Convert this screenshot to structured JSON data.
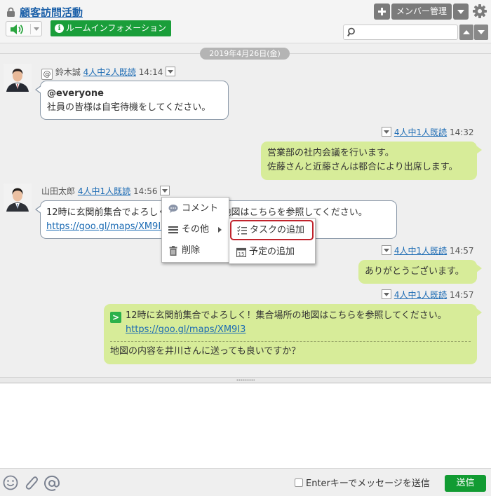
{
  "header": {
    "room_title": "顧客訪問活動",
    "info_button": "ルームインフォメーション",
    "member_button": "メンバー管理",
    "search_placeholder": ""
  },
  "date_separator": "2019年4月26日(金)",
  "messages": [
    {
      "sender": "鈴木誠",
      "read": "4人中2人既読",
      "time": "14:14",
      "line1": "@everyone",
      "line2": "社員の皆様は自宅待機をしてください。"
    },
    {
      "read": "4人中1人既読",
      "time": "14:32",
      "line1": "営業部の社内会議を行います。",
      "line2": "佐藤さんと近藤さんは都合により出席します。"
    },
    {
      "sender": "山田太郎",
      "read": "4人中1人既読",
      "time": "14:56",
      "line1": "12時に玄関前集合でよろしく！集合場所の地図はこちらを参照してください。",
      "link": "https://goo.gl/maps/XM9I3"
    },
    {
      "read": "4人中1人既読",
      "time": "14:57",
      "line1": "ありがとうございます。"
    },
    {
      "read": "4人中1人既読",
      "time": "14:57",
      "quote": "12時に玄関前集合でよろしく！集合場所の地図はこちらを参照してください。",
      "link": "https://goo.gl/maps/XM9I3",
      "reply": "地図の内容を井川さんに送っても良いですか？"
    }
  ],
  "context_menu": {
    "comment": "コメント",
    "other": "その他",
    "delete": "削除"
  },
  "submenu": {
    "add_task": "タスクの追加",
    "add_schedule": "予定の追加"
  },
  "footer": {
    "enter_label": "Enterキーでメッセージを送信",
    "send": "送信"
  },
  "colors": {
    "accent_green": "#1a9e3a",
    "bubble_out": "#d7ec99",
    "link_blue": "#1a6ab3",
    "highlight_red": "#c0232c"
  }
}
